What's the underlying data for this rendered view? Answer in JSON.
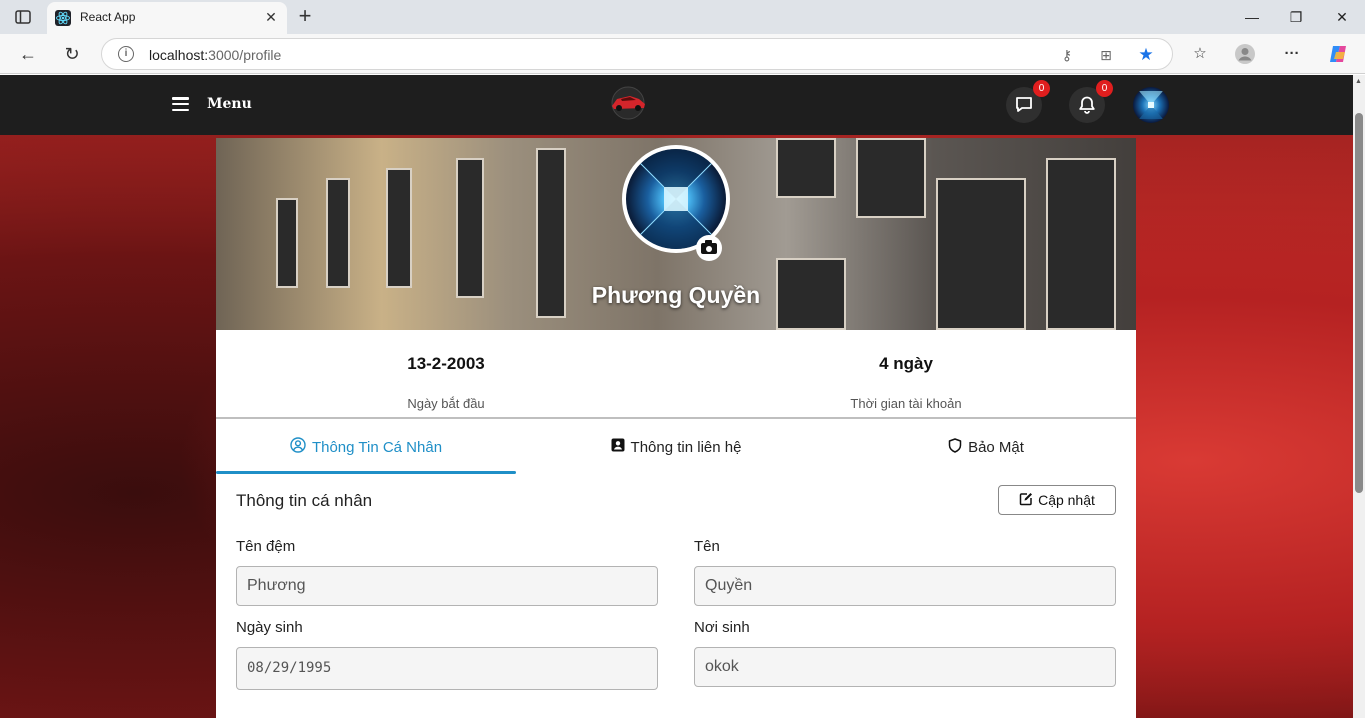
{
  "browser": {
    "tab_title": "React App",
    "url_host": "localhost:",
    "url_path": "3000/profile"
  },
  "navbar": {
    "menu_label": "Menu",
    "messages_count": "0",
    "notifications_count": "0"
  },
  "profile": {
    "name": "Phương Quyền",
    "stats": [
      {
        "value": "13-2-2003",
        "label": "Ngày bắt đầu"
      },
      {
        "value": "4 ngày",
        "label": "Thời gian tài khoản"
      }
    ]
  },
  "tabs": [
    {
      "label": "Thông Tin Cá Nhân",
      "icon": "user-circle-icon",
      "active": true
    },
    {
      "label": "Thông tin liên hệ",
      "icon": "contact-card-icon",
      "active": false
    },
    {
      "label": "Bảo Mật",
      "icon": "shield-icon",
      "active": false
    }
  ],
  "personal_info": {
    "section_title": "Thông tin cá nhân",
    "update_label": "Cập nhật",
    "fields": {
      "middle_name": {
        "label": "Tên đệm",
        "value": "Phương"
      },
      "first_name": {
        "label": "Tên",
        "value": "Quyền"
      },
      "birth_date": {
        "label": "Ngày sinh",
        "value": "08/29/1995"
      },
      "birth_place": {
        "label": "Nơi sinh",
        "value": "okok"
      }
    }
  },
  "colors": {
    "accent": "#1f8fc7",
    "navbar_bg": "#1e1e1e",
    "badge": "#e01e1e"
  }
}
